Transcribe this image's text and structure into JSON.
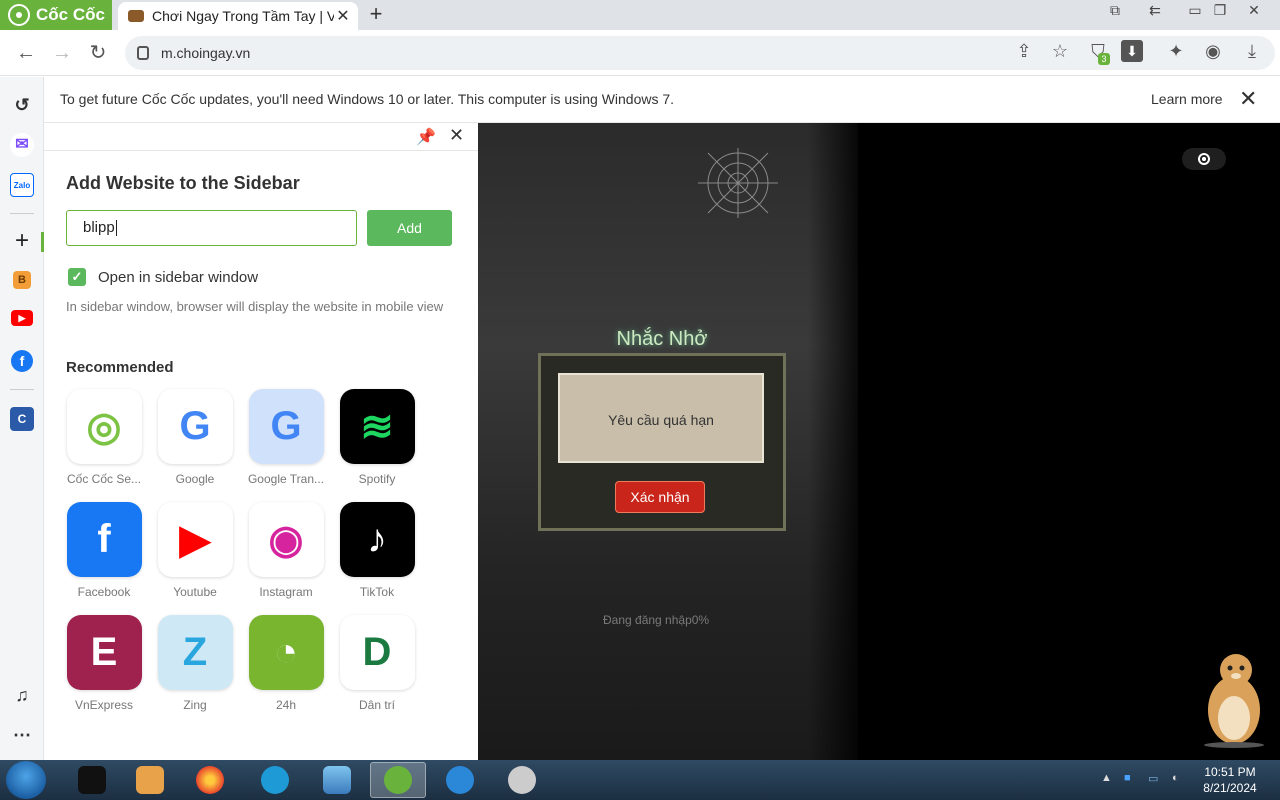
{
  "browser": {
    "brand": "Cốc Cốc",
    "tab_title": "Chơi Ngay Trong Tầm Tay | V",
    "tab_close": "✕",
    "new_tab": "+",
    "url": "m.choingay.vn",
    "extension_badge": "3"
  },
  "infobar": {
    "message": "To get future Cốc Cốc updates, you'll need Windows 10 or later. This computer is using Windows 7.",
    "learn_more": "Learn more",
    "close": "✕"
  },
  "sidebar_rail": {
    "items": [
      "history-icon",
      "messenger-icon",
      "zalo-icon",
      "add-icon",
      "blogger-icon",
      "youtube-icon",
      "facebook-icon",
      "coccoc-game-icon",
      "bell-icon",
      "more-icon"
    ]
  },
  "panel": {
    "title": "Add Website to the Sidebar",
    "input_value": "blipp",
    "add_label": "Add",
    "checkbox_label": "Open in sidebar window",
    "checkbox_checked": true,
    "hint": "In sidebar window, browser will display the website in mobile view",
    "recommended_heading": "Recommended",
    "recommended": [
      {
        "label": "Cốc Cốc Se...",
        "color": "#ffffff",
        "glyph": "◎",
        "fg": "#7cc243"
      },
      {
        "label": "Google",
        "color": "#ffffff",
        "glyph": "G",
        "fg": "#4285f4"
      },
      {
        "label": "Google Tran...",
        "color": "#cfe1fb",
        "glyph": "G",
        "fg": "#4285f4"
      },
      {
        "label": "Spotify",
        "color": "#000000",
        "glyph": "≋",
        "fg": "#1ed760"
      },
      {
        "label": "Facebook",
        "color": "#1877f2",
        "glyph": "f",
        "fg": "#ffffff"
      },
      {
        "label": "Youtube",
        "color": "#ffffff",
        "glyph": "▶",
        "fg": "#ff0000"
      },
      {
        "label": "Instagram",
        "color": "#ffffff",
        "glyph": "◉",
        "fg": "#d6249f"
      },
      {
        "label": "TikTok",
        "color": "#000000",
        "glyph": "♪",
        "fg": "#ffffff"
      },
      {
        "label": "VnExpress",
        "color": "#9f224e",
        "glyph": "E",
        "fg": "#ffffff"
      },
      {
        "label": "Zing",
        "color": "#cfe8f5",
        "glyph": "Z",
        "fg": "#2aa6de"
      },
      {
        "label": "24h",
        "color": "#7ab530",
        "glyph": "◔",
        "fg": "#ffffff"
      },
      {
        "label": "Dân trí",
        "color": "#ffffff",
        "glyph": "D",
        "fg": "#1a7a3f"
      }
    ]
  },
  "game": {
    "dialog_title": "Nhắc Nhở",
    "dialog_message": "Yêu cầu quá hạn",
    "confirm_label": "Xác nhận",
    "loading_text": "Đang đăng nhập0%"
  },
  "taskbar": {
    "time": "10:51 PM",
    "date": "8/21/2024"
  },
  "colors": {
    "brand_green": "#69b33d",
    "add_button": "#5cb85c",
    "confirm_red": "#c9251a"
  }
}
